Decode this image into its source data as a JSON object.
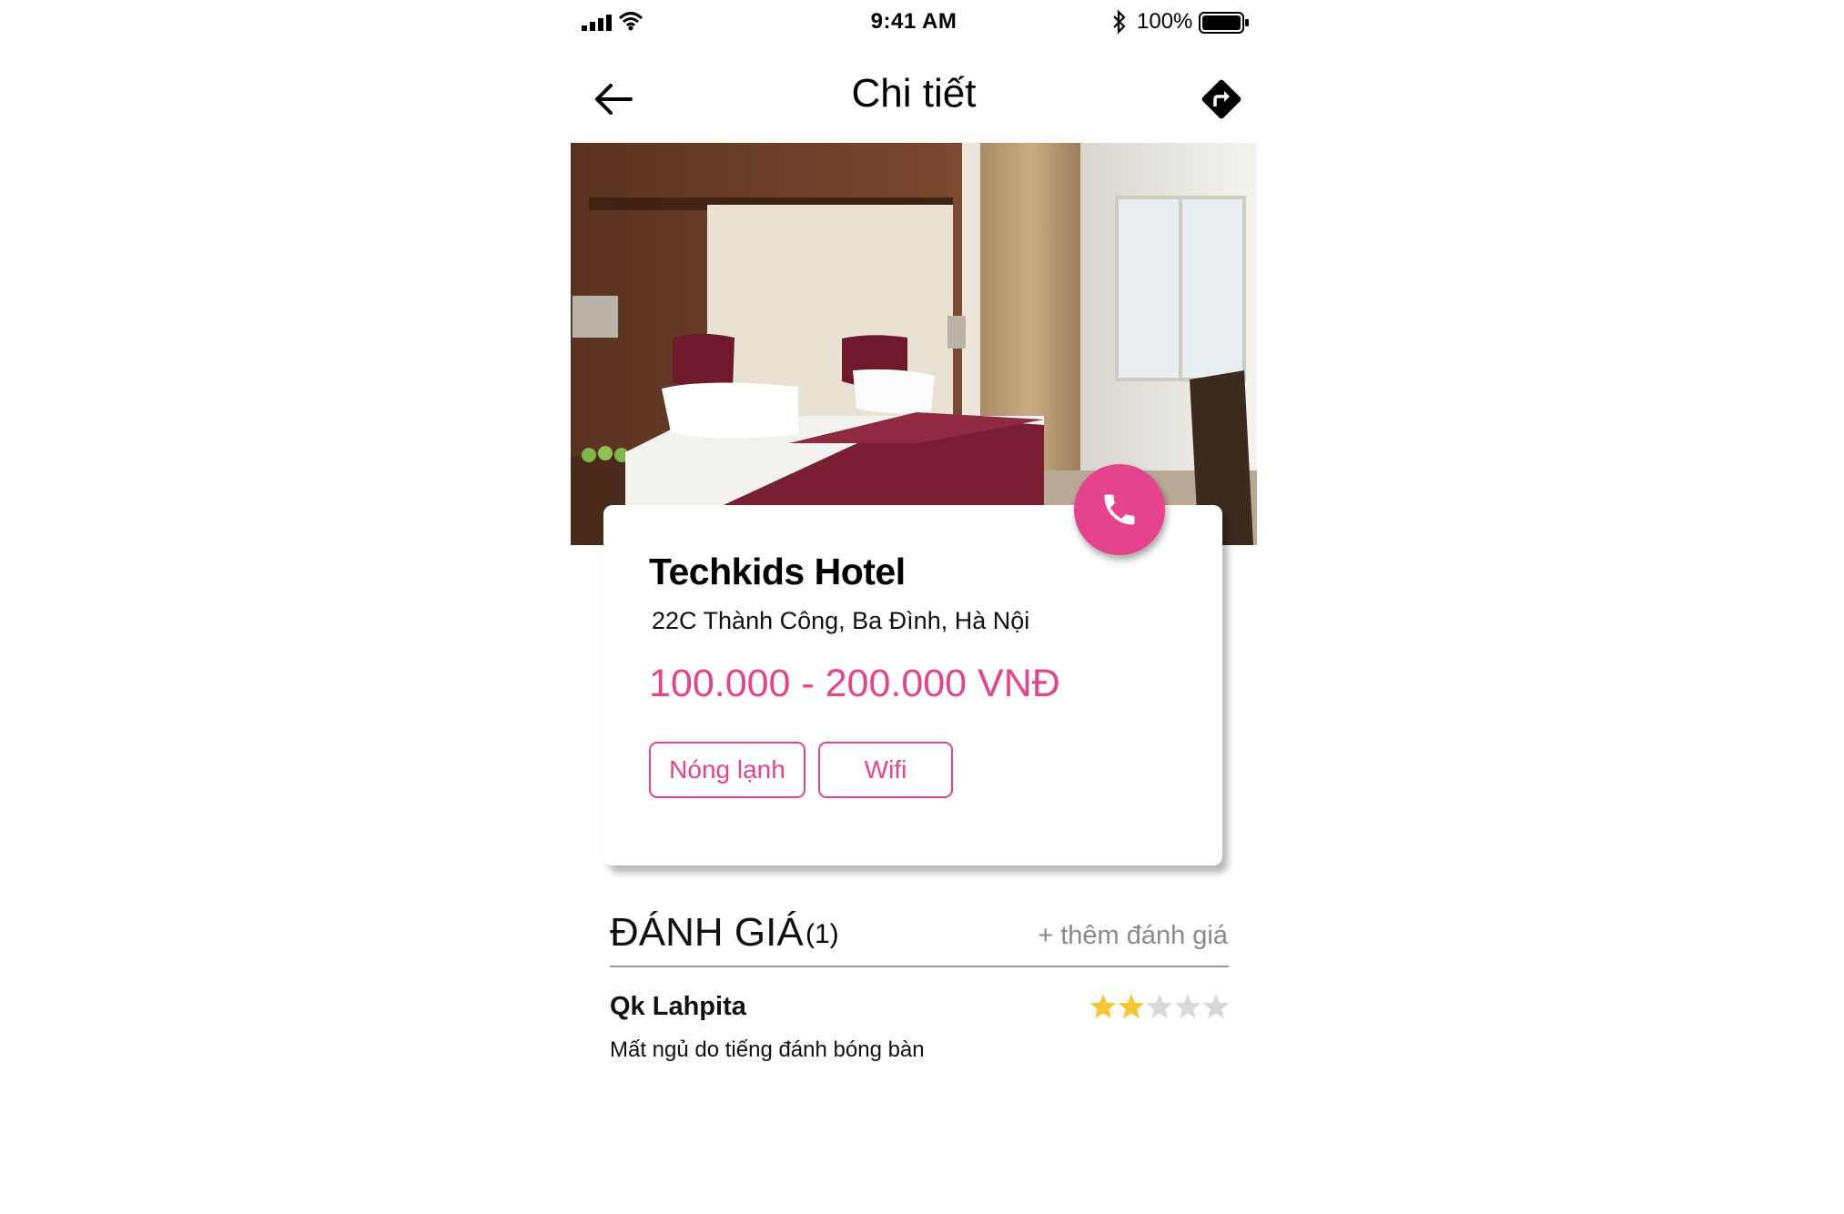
{
  "status_bar": {
    "time": "9:41 AM",
    "battery": "100%"
  },
  "header": {
    "title": "Chi tiết",
    "back_icon": "arrow-left-icon",
    "directions_icon": "directions-icon"
  },
  "hotel": {
    "name": "Techkids Hotel",
    "address": "22C Thành Công, Ba Đình, Hà Nội",
    "price": "100.000 - 200.000 VNĐ",
    "amenities": [
      "Nóng lạnh",
      "Wifi"
    ]
  },
  "colors": {
    "accent": "#e5438c"
  },
  "reviews": {
    "title": "ĐÁNH GIÁ",
    "count": "(1)",
    "add_label": "+ thêm đánh giá",
    "items": [
      {
        "author": "Qk Lahpita",
        "rating": 2,
        "max_rating": 5,
        "comment": "Mất ngủ do tiếng đánh bóng bàn"
      }
    ]
  }
}
